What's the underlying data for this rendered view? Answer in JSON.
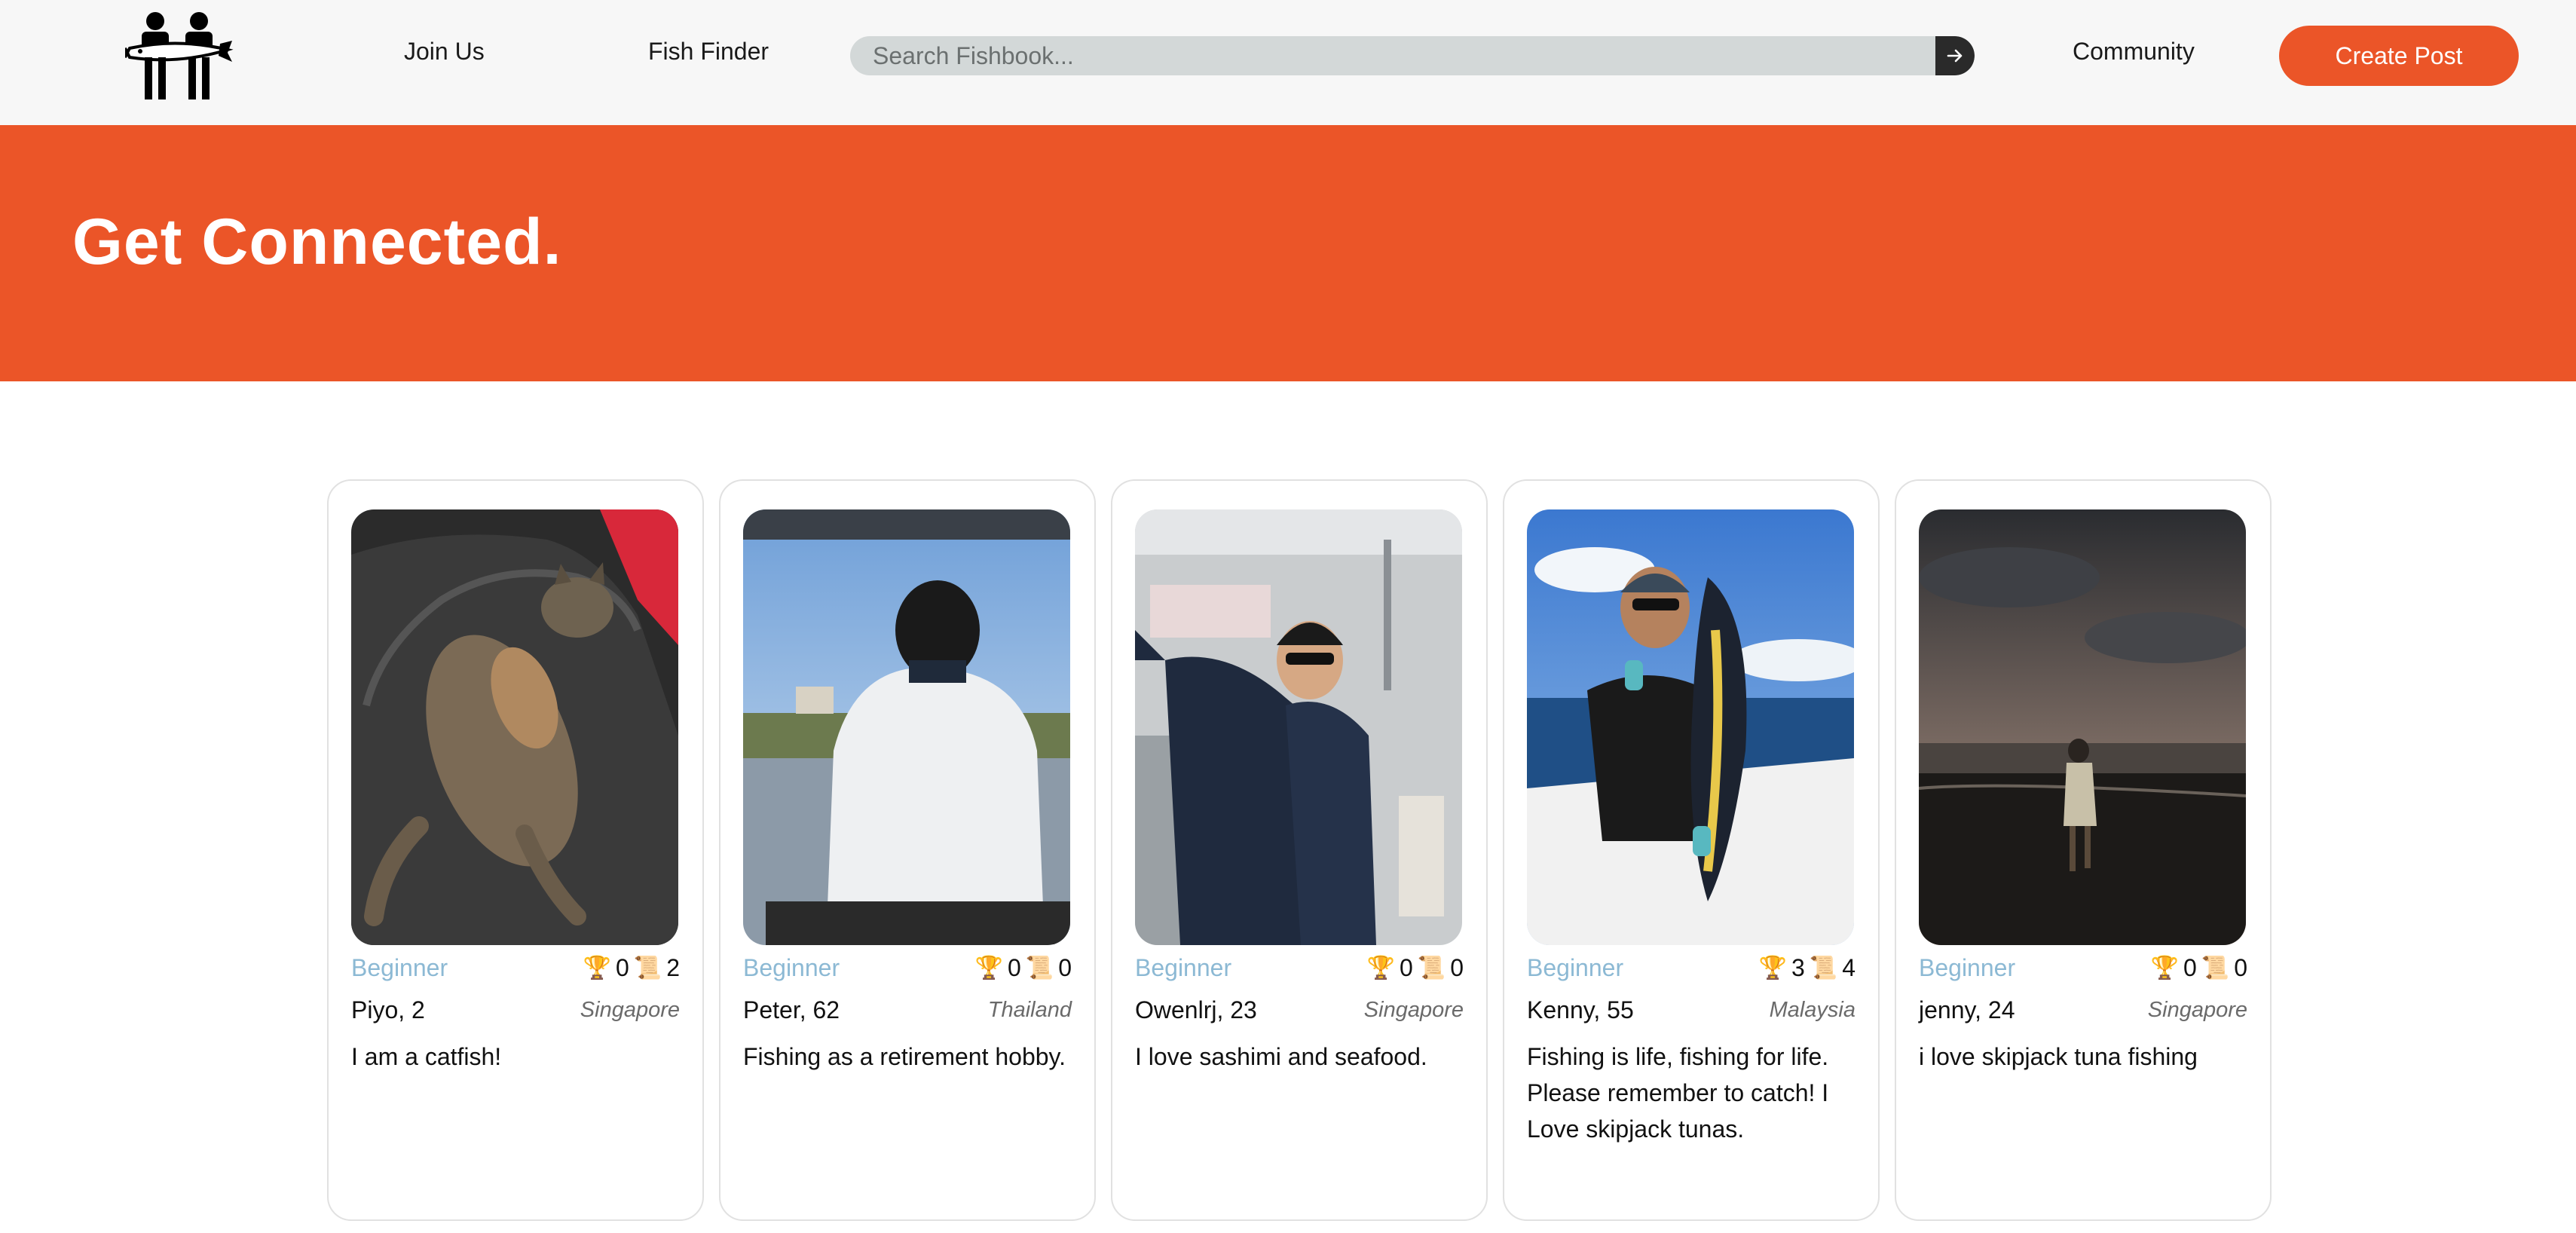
{
  "nav": {
    "join_label": "Join Us",
    "fish_finder_label": "Fish Finder",
    "community_label": "Community",
    "create_post_label": "Create Post",
    "search_placeholder": "Search Fishbook..."
  },
  "hero": {
    "title": "Get Connected."
  },
  "icons": {
    "logo": "fishermen-logo",
    "search_submit": "arrow-right-icon",
    "trophy": "trophy-icon",
    "post": "scroll-icon"
  },
  "colors": {
    "accent": "#eb5528",
    "level_text": "#8cb9d4",
    "search_bg": "#d3d8d8"
  },
  "profiles": [
    {
      "level": "Beginner",
      "trophies": "0",
      "posts": "2",
      "name": "Piyo, 2",
      "country": "Singapore",
      "bio": "I am a catfish!"
    },
    {
      "level": "Beginner",
      "trophies": "0",
      "posts": "0",
      "name": "Peter, 62",
      "country": "Thailand",
      "bio": "Fishing as a retirement hobby."
    },
    {
      "level": "Beginner",
      "trophies": "0",
      "posts": "0",
      "name": "Owenlrj, 23",
      "country": "Singapore",
      "bio": "I love sashimi and seafood."
    },
    {
      "level": "Beginner",
      "trophies": "3",
      "posts": "4",
      "name": "Kenny, 55",
      "country": "Malaysia",
      "bio": "Fishing is life, fishing for life. Please remember to catch! I Love skipjack tunas."
    },
    {
      "level": "Beginner",
      "trophies": "0",
      "posts": "0",
      "name": "jenny, 24",
      "country": "Singapore",
      "bio": "i love skipjack tuna fishing"
    }
  ]
}
